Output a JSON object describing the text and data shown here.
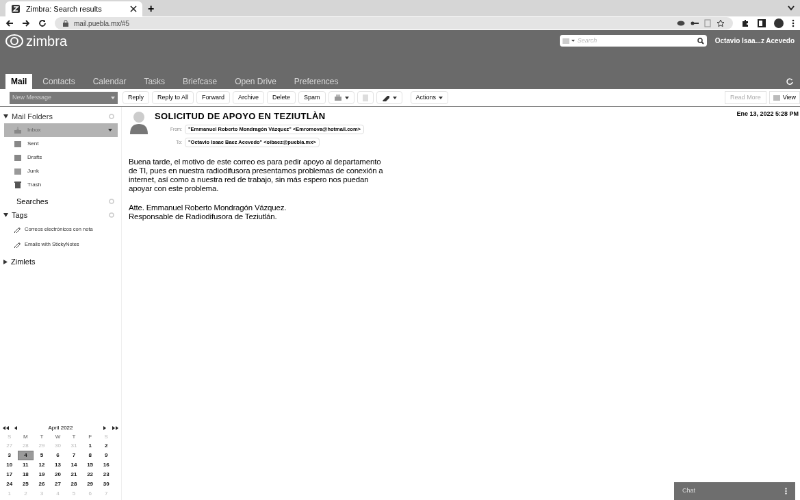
{
  "browser": {
    "tab_title": "Zimbra: Search results",
    "new_tab": "+",
    "url": "mail.puebla.mx/#5"
  },
  "app": {
    "logo_text": "zimbra",
    "search_placeholder": "Search",
    "user": "Octavio Isaa...z Acevedo",
    "tabs": [
      {
        "label": "Mail",
        "selected": true
      },
      {
        "label": "Contacts",
        "selected": false
      },
      {
        "label": "Calendar",
        "selected": false
      },
      {
        "label": "Tasks",
        "selected": false
      },
      {
        "label": "Briefcase",
        "selected": false
      },
      {
        "label": "Open Drive",
        "selected": false
      },
      {
        "label": "Preferences",
        "selected": false
      }
    ]
  },
  "toolbar": {
    "new_message": "New Message",
    "buttons": [
      {
        "kind": "text",
        "label": "Reply"
      },
      {
        "kind": "text",
        "label": "Reply to All"
      },
      {
        "kind": "text",
        "label": "Forward"
      },
      {
        "kind": "text",
        "label": "Archive"
      },
      {
        "kind": "text",
        "label": "Delete"
      },
      {
        "kind": "text",
        "label": "Spam"
      },
      {
        "kind": "print"
      },
      {
        "kind": "note"
      },
      {
        "kind": "tag"
      },
      {
        "kind": "menu",
        "label": "Actions"
      }
    ],
    "read_more": "Read More",
    "view": "View"
  },
  "sidebar": {
    "mail_folders": {
      "label": "Mail Folders",
      "expanded": true,
      "items": [
        {
          "kind": "inbox",
          "label": "Inbox",
          "selected": true
        },
        {
          "kind": "sent",
          "label": "Sent",
          "selected": false
        },
        {
          "kind": "drafts",
          "label": "Drafts",
          "selected": false
        },
        {
          "kind": "junk",
          "label": "Junk",
          "selected": false
        },
        {
          "kind": "trash",
          "label": "Trash",
          "selected": false
        }
      ]
    },
    "searches": "Searches",
    "tags": {
      "label": "Tags",
      "expanded": true,
      "items": [
        "Correos electrónicos con nota",
        "Emails with StickyNotes"
      ]
    },
    "zimlets": {
      "label": "Zimlets",
      "expanded": false
    }
  },
  "calendar": {
    "month": "April 2022",
    "weekdays": [
      "S",
      "M",
      "T",
      "W",
      "T",
      "F",
      "S"
    ],
    "weeks": [
      [
        {
          "day": "27",
          "other": true,
          "selected": false
        },
        {
          "day": "28",
          "other": true,
          "selected": false
        },
        {
          "day": "29",
          "other": true,
          "selected": false
        },
        {
          "day": "30",
          "other": true,
          "selected": false
        },
        {
          "day": "31",
          "other": true,
          "selected": false
        },
        {
          "day": "1",
          "other": false,
          "selected": false
        },
        {
          "day": "2",
          "other": false,
          "selected": false
        }
      ],
      [
        {
          "day": "3",
          "other": false,
          "selected": false
        },
        {
          "day": "4",
          "other": false,
          "selected": true
        },
        {
          "day": "5",
          "other": false,
          "selected": false
        },
        {
          "day": "6",
          "other": false,
          "selected": false
        },
        {
          "day": "7",
          "other": false,
          "selected": false
        },
        {
          "day": "8",
          "other": false,
          "selected": false
        },
        {
          "day": "9",
          "other": false,
          "selected": false
        }
      ],
      [
        {
          "day": "10",
          "other": false,
          "selected": false
        },
        {
          "day": "11",
          "other": false,
          "selected": false
        },
        {
          "day": "12",
          "other": false,
          "selected": false
        },
        {
          "day": "13",
          "other": false,
          "selected": false
        },
        {
          "day": "14",
          "other": false,
          "selected": false
        },
        {
          "day": "15",
          "other": false,
          "selected": false
        },
        {
          "day": "16",
          "other": false,
          "selected": false
        }
      ],
      [
        {
          "day": "17",
          "other": false,
          "selected": false
        },
        {
          "day": "18",
          "other": false,
          "selected": false
        },
        {
          "day": "19",
          "other": false,
          "selected": false
        },
        {
          "day": "20",
          "other": false,
          "selected": false
        },
        {
          "day": "21",
          "other": false,
          "selected": false
        },
        {
          "day": "22",
          "other": false,
          "selected": false
        },
        {
          "day": "23",
          "other": false,
          "selected": false
        }
      ],
      [
        {
          "day": "24",
          "other": false,
          "selected": false
        },
        {
          "day": "25",
          "other": false,
          "selected": false
        },
        {
          "day": "26",
          "other": false,
          "selected": false
        },
        {
          "day": "27",
          "other": false,
          "selected": false
        },
        {
          "day": "28",
          "other": false,
          "selected": false
        },
        {
          "day": "29",
          "other": false,
          "selected": false
        },
        {
          "day": "30",
          "other": false,
          "selected": false
        }
      ],
      [
        {
          "day": "1",
          "other": true,
          "selected": false
        },
        {
          "day": "2",
          "other": true,
          "selected": false
        },
        {
          "day": "3",
          "other": true,
          "selected": false
        },
        {
          "day": "4",
          "other": true,
          "selected": false
        },
        {
          "day": "5",
          "other": true,
          "selected": false
        },
        {
          "day": "6",
          "other": true,
          "selected": false
        },
        {
          "day": "7",
          "other": true,
          "selected": false
        }
      ]
    ]
  },
  "message": {
    "subject": "SOLICITUD DE APOYO EN TEZIUTLÀN",
    "date": "Ene 13, 2022 5:28 PM",
    "from_label": "From:",
    "from": "\"Emmanuel Roberto Mondragón Vázquez\" <Emromova@hotmail.com>",
    "to_label": "To:",
    "to": "\"Octavio Isaac Baez Acevedo\" <oibaez@puebla.mx>",
    "body": [
      "Buena tarde, el motivo de este correo es para pedir apoyo al departamento de TI, pues en nuestra radiodifusora presentamos problemas de conexión a internet, así como a nuestra red de trabajo, sin más espero nos puedan apoyar con este problema.",
      "Atte. Emmanuel Roberto Mondragón Vázquez.\nResponsable de Radiodifusora de Teziutlán."
    ]
  },
  "chat": {
    "label": "Chat"
  }
}
